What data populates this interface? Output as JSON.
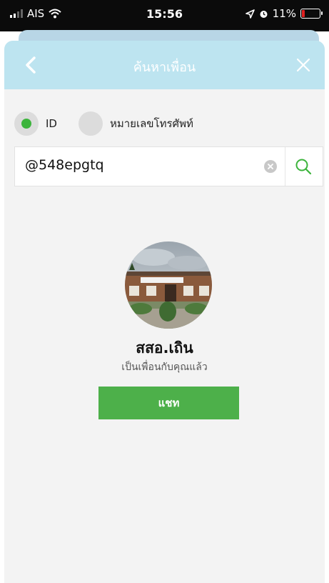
{
  "status_bar": {
    "carrier": "AIS",
    "time": "15:56",
    "battery": "11%"
  },
  "header": {
    "title": "ค้นหาเพื่อน",
    "back_icon": "chevron-left-icon",
    "close_icon": "close-icon"
  },
  "search_type": {
    "options": [
      {
        "label": "ID",
        "selected": true
      },
      {
        "label": "หมายเลขโทรศัพท์",
        "selected": false
      }
    ]
  },
  "search": {
    "value": "@548epgtq",
    "clear_icon": "clear-icon",
    "search_icon": "search-icon"
  },
  "result": {
    "name": "สสอ.เถิน",
    "status": "เป็นเพื่อนกับคุณแล้ว",
    "chat_label": "แชท"
  },
  "colors": {
    "header": "#bde4f0",
    "accent_green": "#4db04a",
    "background": "#f3f3f3"
  }
}
